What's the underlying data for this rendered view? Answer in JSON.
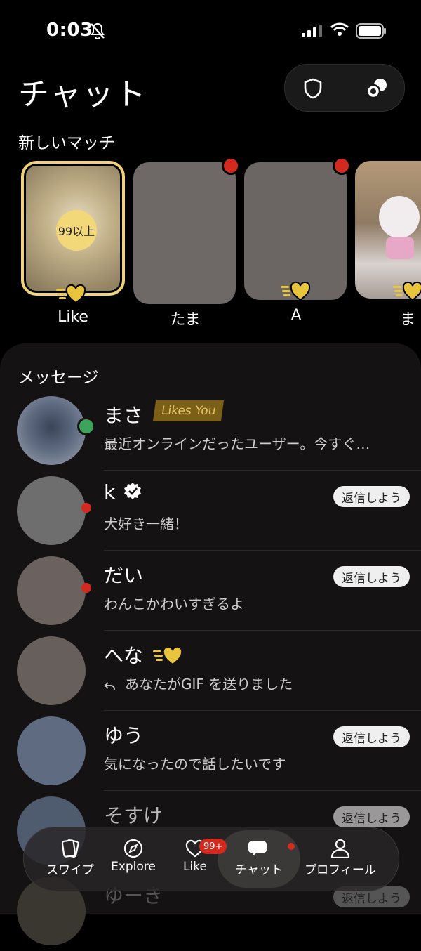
{
  "status": {
    "time": "0:03"
  },
  "header": {
    "title": "チャット"
  },
  "new_matches": {
    "label": "新しいマッチ",
    "items": [
      {
        "name": "Like",
        "count": "99以上"
      },
      {
        "name": "たま"
      },
      {
        "name": "A"
      },
      {
        "name": "ま"
      }
    ]
  },
  "messages": {
    "label": "メッセージ",
    "rows": [
      {
        "name": "まさ",
        "tag": "Likes You",
        "preview": "最近オンラインだったユーザー。今すぐ…"
      },
      {
        "name": "k",
        "preview": "犬好き一緒！",
        "reply": "返信しよう"
      },
      {
        "name": "だい",
        "preview": "わんこかわいすぎるよ",
        "reply": "返信しよう"
      },
      {
        "name": "へな",
        "preview": "あなたがGIF を送りました"
      },
      {
        "name": "ゆう",
        "preview": "気になったので話したいです",
        "reply": "返信しよう"
      },
      {
        "name": "そすけ",
        "reply": "返信しよう"
      },
      {
        "name": "ゆーき",
        "reply": "返信しよう"
      }
    ]
  },
  "tabs": [
    {
      "label": "スワイプ"
    },
    {
      "label": "Explore"
    },
    {
      "label": "Like",
      "badge": "99+"
    },
    {
      "label": "チャット"
    },
    {
      "label": "プロフィール"
    }
  ],
  "colors": {
    "accent": "#f1d27b",
    "red": "#d32a1f",
    "online": "#3fa45b"
  }
}
